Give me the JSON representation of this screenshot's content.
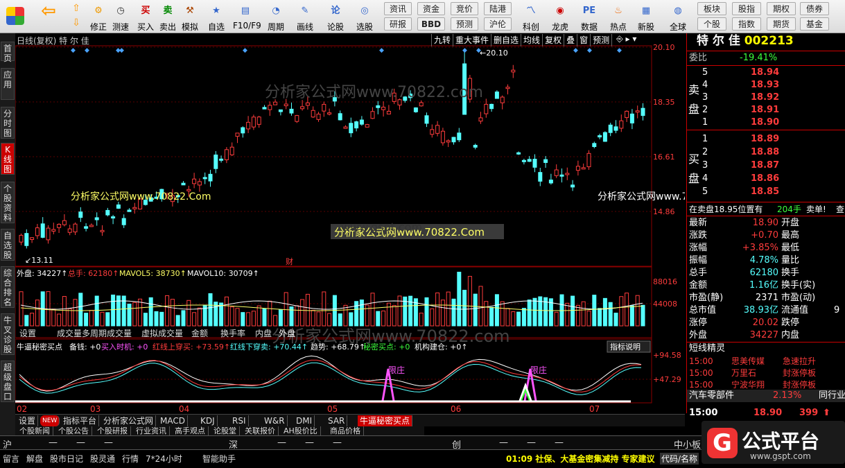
{
  "toolbar": {
    "buttons": [
      "",
      "",
      "修正",
      "测速",
      "买入",
      "卖出",
      "模拟",
      "自选",
      "F10/F9",
      "周期",
      "画线",
      "论股",
      "选股",
      "",
      "",
      "",
      "龙虎",
      "数据",
      "热点",
      "新股",
      "全球"
    ],
    "small": [
      "资讯",
      "资金",
      "竞价",
      "陆港",
      "研报",
      "BBD",
      "预测",
      "沪伦"
    ],
    "right": [
      "板块",
      "股指",
      "期权",
      "债券",
      "个股",
      "指数",
      "期货",
      "基金"
    ]
  },
  "left_tabs": [
    "首页",
    "应用",
    "分时图",
    "K线图",
    "个股资料",
    "自选股",
    "综合排名",
    "牛叉诊股",
    "超级盘口"
  ],
  "chart": {
    "header_left": "日线(复权)  特 尔 佳",
    "header_right": [
      "九转",
      "重大事件",
      "删自选",
      "均线",
      "复权",
      "叠",
      "窗",
      "预测"
    ],
    "price_labels": [
      "20.10",
      "18.35",
      "16.61",
      "14.86"
    ],
    "high_mark": "20.10",
    "low_mark": "13.11",
    "cai": "财",
    "vol_header": {
      "wai": "外盘: 34227",
      "zongshou": "总手: 62180",
      "mavol5": "MAVOL5: 38730",
      "mavol10": "MAVOL10: 30709"
    },
    "vol_labels": [
      "88016",
      "44008"
    ],
    "vol_tabs": [
      "设置",
      "成交量",
      "多周期成交量",
      "虚拟成交量",
      "金额",
      "换手率",
      "内盘",
      "外盘"
    ],
    "ind_header": {
      "name": "牛逼秘密买点",
      "a": "备钱: +0",
      "b": "买入时机: +0",
      "c": "红线上穿买: +73.59",
      "d": "红线下穿卖: +70.44",
      "e": "趋势: +68.79",
      "f": "秘密买点: +0",
      "g": "机构建仓: +0"
    },
    "ind_btn": "指标说明",
    "ind_labels": [
      "+94.58",
      "+47.29"
    ],
    "xianzhuang": "限庄",
    "months": [
      "02",
      "03",
      "04",
      "05",
      "06",
      "07"
    ],
    "watermarks": [
      "分析家公式网www.70822.com",
      "分析家公式网www.70822.Com",
      "分析家公式网www.70822.Com",
      "分析家公式网www.70822.Com",
      "分析家公式网www.70822.com"
    ]
  },
  "right": {
    "name": "特 尔 佳",
    "code": "002213",
    "weibi_label": "委比",
    "weibi": "-19.41%",
    "sell": [
      [
        "5",
        "18.94"
      ],
      [
        "4",
        "18.93"
      ],
      [
        "3",
        "18.92"
      ],
      [
        "2",
        "18.91"
      ],
      [
        "1",
        "18.90"
      ]
    ],
    "buy": [
      [
        "1",
        "18.89"
      ],
      [
        "2",
        "18.88"
      ],
      [
        "3",
        "18.87"
      ],
      [
        "4",
        "18.86"
      ],
      [
        "5",
        "18.85"
      ]
    ],
    "sell_label": "卖盘",
    "buy_label": "买盘",
    "line1": "在卖盘18.95位置有",
    "line1b": "204手",
    "line1c": "卖单!",
    "line1d": "查",
    "quotes": [
      [
        "最新",
        "18.90",
        "开盘",
        ""
      ],
      [
        "涨跌",
        "+0.70",
        "最高",
        ""
      ],
      [
        "涨幅",
        "+3.85%",
        "最低",
        ""
      ],
      [
        "振幅",
        "4.78%",
        "量比",
        ""
      ],
      [
        "总手",
        "62180",
        "换手",
        ""
      ],
      [
        "金额",
        "1.16亿",
        "换手(实)",
        ""
      ],
      [
        "市盈(静)",
        "2371",
        "市盈(动)",
        ""
      ],
      [
        "总市值",
        "38.93亿",
        "流通值",
        "9"
      ],
      [
        "涨停",
        "20.02",
        "跌停",
        ""
      ],
      [
        "外盘",
        "34227",
        "内盘",
        ""
      ]
    ],
    "jingling": "短线精灵",
    "jl_rows": [
      [
        "15:00",
        "思美传媒",
        "急速拉升"
      ],
      [
        "15:00",
        "万里石",
        "封涨停板"
      ],
      [
        "15:00",
        "宁波华翔",
        "封涨停板"
      ]
    ],
    "sector": "汽车零部件",
    "sector_pct": "2.13%",
    "sector_r": "同行业",
    "time": "15:00",
    "price": "18.90",
    "vol": "399"
  },
  "bottom_tabs": [
    "设置",
    "NEW",
    "指标平台",
    "分析家公式网",
    "MACD",
    "KDJ",
    "RSI",
    "W&R",
    "DMI",
    "SAR",
    "牛逼秘密买点"
  ],
  "sub_tabs": [
    "个股新闻",
    "个股公告",
    "个股研报",
    "行业资讯",
    "高手观点",
    "论股堂",
    "关联报价",
    "AH股价比",
    "商品价格"
  ],
  "idx": [
    "沪",
    "—",
    "—",
    "—",
    "深",
    "—",
    "—",
    "—",
    "创",
    "—",
    "—",
    "—",
    "中小板"
  ],
  "status": [
    "留言",
    "解盘",
    "股市日记",
    "股灵通",
    "行情",
    "7*24小时",
    "智能助手"
  ],
  "ticker": "01:09 社保、大基金密集减持 专家建议",
  "ticker_r": "代码/名称",
  "logo": {
    "text": "公式平台",
    "url": "www.gspt.com"
  },
  "center_wm": "www.gspt.com"
}
